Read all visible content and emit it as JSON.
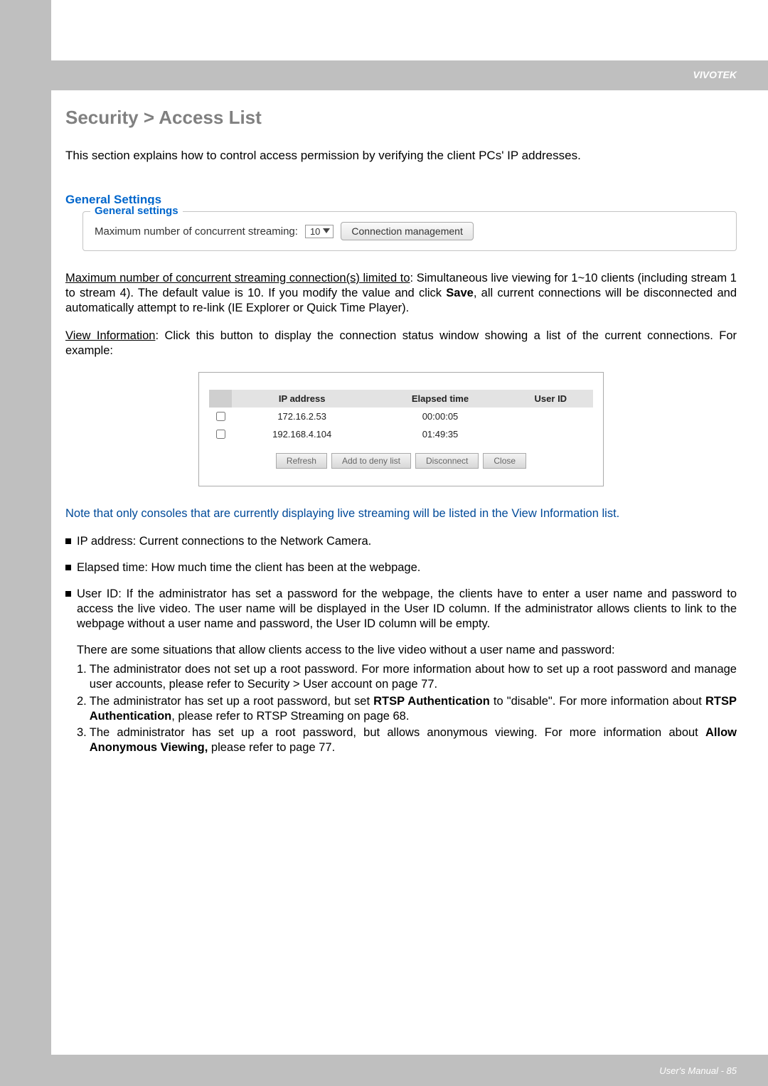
{
  "header": {
    "brand": "VIVOTEK"
  },
  "title": "Security >  Access List",
  "intro": "This section explains how to control access permission by verifying the client PCs' IP addresses.",
  "general": {
    "heading": "General Settings",
    "legend": "General settings",
    "label": "Maximum number of concurrent streaming:",
    "selectValue": "10",
    "button": "Connection management"
  },
  "para1_u": "Maximum number of concurrent streaming connection(s) limited to",
  "para1_rest": ": Simultaneous live viewing for 1~10 clients (including stream 1 to stream 4). The default value is 10. If you modify the value and click ",
  "para1_b": "Save",
  "para1_tail": ", all current connections will be disconnected and automatically attempt to re-link (IE Explorer or Quick Time Player).",
  "para2_u": "View Information",
  "para2_rest": ": Click this button to display the connection status window showing a list of the current connections. For example:",
  "connTable": {
    "headers": [
      "IP address",
      "Elapsed time",
      "User ID"
    ],
    "rows": [
      {
        "ip": "172.16.2.53",
        "elapsed": "00:00:05",
        "user": ""
      },
      {
        "ip": "192.168.4.104",
        "elapsed": "01:49:35",
        "user": ""
      }
    ],
    "buttons": [
      "Refresh",
      "Add to deny list",
      "Disconnect",
      "Close"
    ]
  },
  "note": "Note that only consoles that are currently displaying live streaming will be listed in the View Information list.",
  "bullets": {
    "ip": "IP address: Current connections to the Network Camera.",
    "elapsed": "Elapsed time: How much time the client has been at the webpage.",
    "user": "User ID: If the administrator has set a password for the webpage, the clients have to enter a user name and password to access the live video. The user name will be displayed in the User ID column. If  the administrator allows clients to link to the webpage without a user name and password, the User ID column will be empty."
  },
  "situations_intro": "There are some situations that allow clients access to the live video without a user name and password:",
  "situations": [
    "The administrator does not set up a root password. For more information about how to set up a root password and manage user accounts, please refer to Security > User account on page 77.",
    "The administrator has set up a root password, but set RTSP Authentication to \"disable\". For more information about RTSP Authentication, please refer to RTSP Streaming on page 68.",
    "The administrator has set up a root password, but allows anonymous viewing. For more information about Allow Anonymous Viewing, please refer to page 77."
  ],
  "sit2_b1": "RTSP Authentication",
  "sit2_b2": "RTSP Authentication",
  "sit3_b": "Allow Anonymous Viewing,",
  "footer": "User's Manual - 85"
}
